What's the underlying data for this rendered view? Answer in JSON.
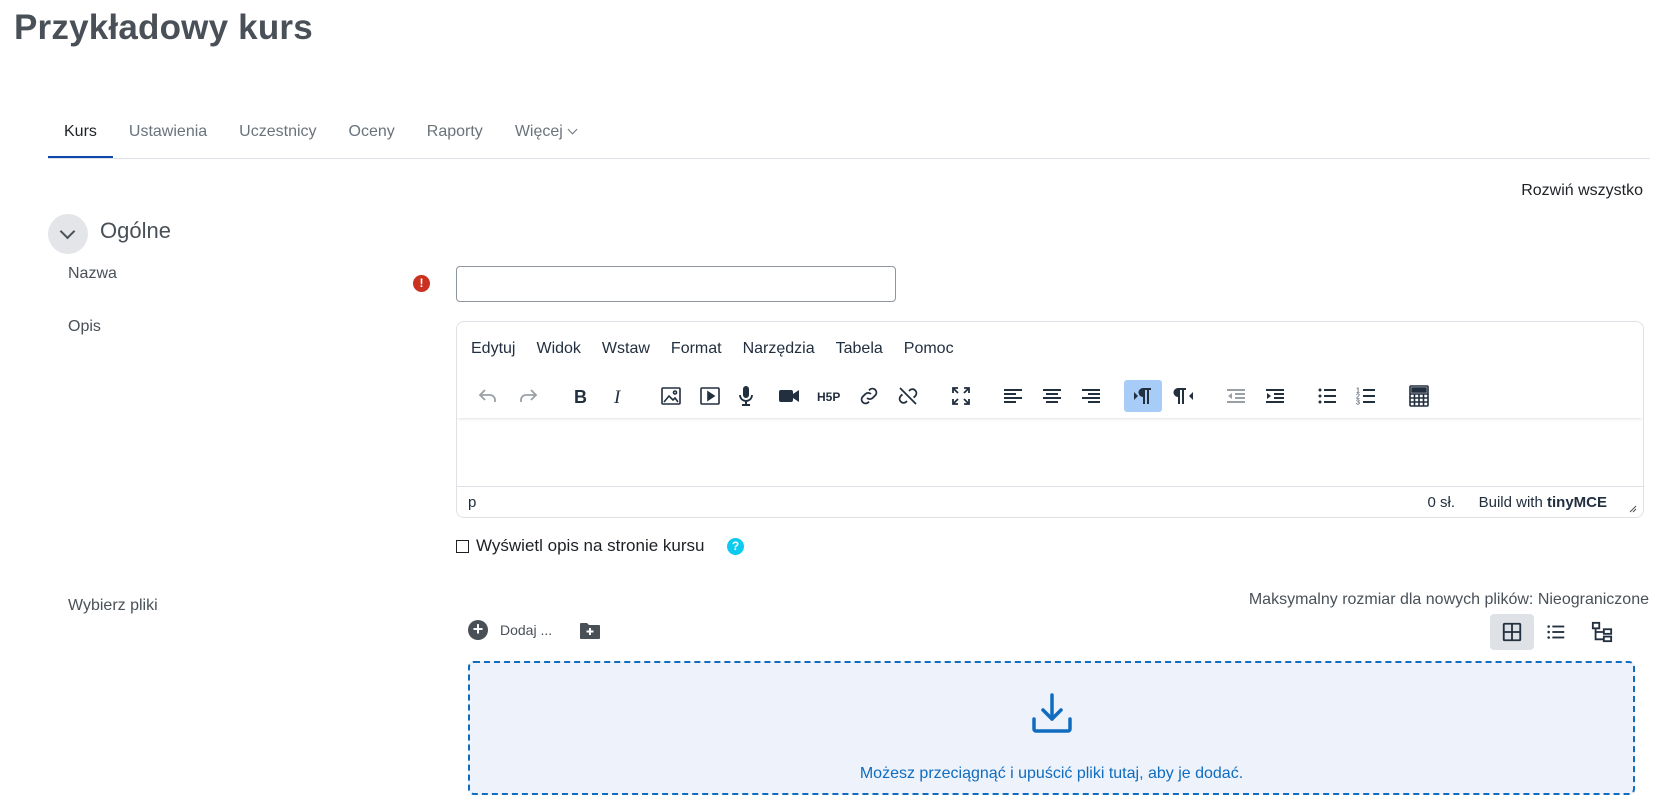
{
  "page": {
    "title": "Przykładowy kurs"
  },
  "tabs": [
    {
      "label": "Kurs",
      "active": true
    },
    {
      "label": "Ustawienia"
    },
    {
      "label": "Uczestnicy"
    },
    {
      "label": "Oceny"
    },
    {
      "label": "Raporty"
    },
    {
      "label": "Więcej"
    }
  ],
  "expand_all": "Rozwiń wszystko",
  "section": {
    "title": "Ogólne",
    "toggle_icon": "chevron-down-icon"
  },
  "fields": {
    "name": {
      "label": "Nazwa",
      "value": "",
      "required_icon": "exclamation-icon"
    },
    "description": {
      "label": "Opis"
    },
    "files": {
      "label": "Wybierz pliki"
    }
  },
  "editor": {
    "menu": [
      "Edytuj",
      "Widok",
      "Wstaw",
      "Format",
      "Narzędzia",
      "Tabela",
      "Pomoc"
    ],
    "toolbar_icons": [
      "undo-icon",
      "redo-icon",
      "bold-icon",
      "italic-icon",
      "image-icon",
      "media-icon",
      "microphone-icon",
      "video-icon",
      "h5p-icon",
      "link-icon",
      "unlink-icon",
      "fullscreen-icon",
      "align-left-icon",
      "align-center-icon",
      "align-right-icon",
      "ltr-icon",
      "rtl-icon",
      "outdent-icon",
      "indent-icon",
      "bullet-list-icon",
      "numbered-list-icon",
      "calculator-icon"
    ],
    "status_path": "p",
    "word_count": "0 sł.",
    "brand_prefix": "Build with",
    "brand_name": "tinyMCE"
  },
  "show_description": {
    "label": "Wyświetl opis na stronie kursu",
    "checked": false,
    "help_icon": "question-icon"
  },
  "filepicker": {
    "max_size": "Maksymalny rozmiar dla nowych plików: Nieograniczone",
    "add_label": "Dodaj ...",
    "dropzone_text": "Możesz przeciągnąć i upuścić pliki tutaj, aby je dodać.",
    "view_icons": [
      "grid-view-icon",
      "list-view-icon",
      "tree-view-icon"
    ]
  },
  "colors": {
    "accent": "#0f6cbf",
    "required": "#ca3120",
    "help": "#0dcaf0",
    "active_tab": "#0f47ad"
  }
}
